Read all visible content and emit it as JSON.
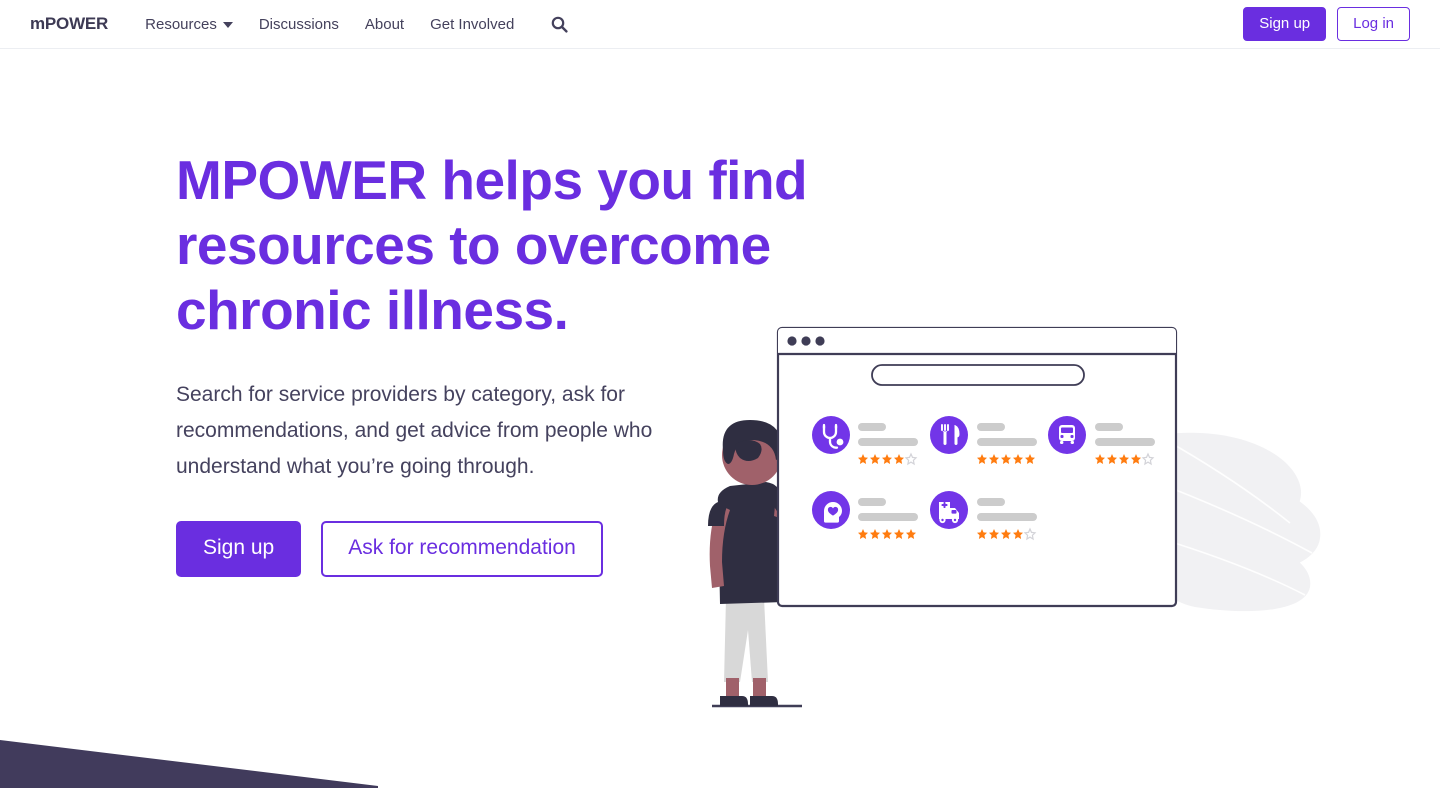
{
  "navbar": {
    "brand": "mPOWER",
    "links": [
      {
        "label": "Resources",
        "icon": "chevron-down-icon",
        "has_caret": true
      },
      {
        "label": "Discussions",
        "has_caret": false
      },
      {
        "label": "About",
        "has_caret": false
      },
      {
        "label": "Get Involved",
        "has_caret": false
      }
    ],
    "search_icon": "search-icon",
    "signup_label": "Sign up",
    "login_label": "Log in"
  },
  "hero": {
    "title": "MPOWER helps you find resources to overcome chronic illness.",
    "subtitle": "Search for service providers by category, ask for recommendations, and get advice from people who understand what you’re going through.",
    "primary_cta": "Sign up",
    "secondary_cta": "Ask for recommendation"
  },
  "illustration": {
    "name": "person-pointing-at-search-results-illustration",
    "browser_window": {
      "dots": 3,
      "search_bar": {
        "placeholder": ""
      },
      "cards": [
        {
          "icon": "stethoscope-icon",
          "category": "medical",
          "rating": 4,
          "max_rating": 5
        },
        {
          "icon": "fork-knife-icon",
          "category": "food",
          "rating": 5,
          "max_rating": 5
        },
        {
          "icon": "bus-icon",
          "category": "transportation",
          "rating": 4,
          "max_rating": 5
        },
        {
          "icon": "head-heart-icon",
          "category": "mental-health",
          "rating": 5,
          "max_rating": 5
        },
        {
          "icon": "ambulance-icon",
          "category": "emergency",
          "rating": 4,
          "max_rating": 5
        }
      ]
    },
    "person": {
      "shirt_color": "#2f2e41",
      "pants_color": "#d8d8d8",
      "skin_color": "#a0616a",
      "hair_color": "#2f2e41",
      "shoe_color": "#2f2e41"
    }
  },
  "decor": {
    "leaf_color": "#f1f1f3",
    "wedge_color": "#413b5c"
  },
  "colors": {
    "brand_purple": "#6a2ee0",
    "icon_purple": "#7235e8",
    "text_dark": "#45425e",
    "star_orange": "#ff7c10",
    "star_empty": "#d3d3d8",
    "bar_gray": "#cccccc",
    "outline_dark": "#3f3d56"
  }
}
